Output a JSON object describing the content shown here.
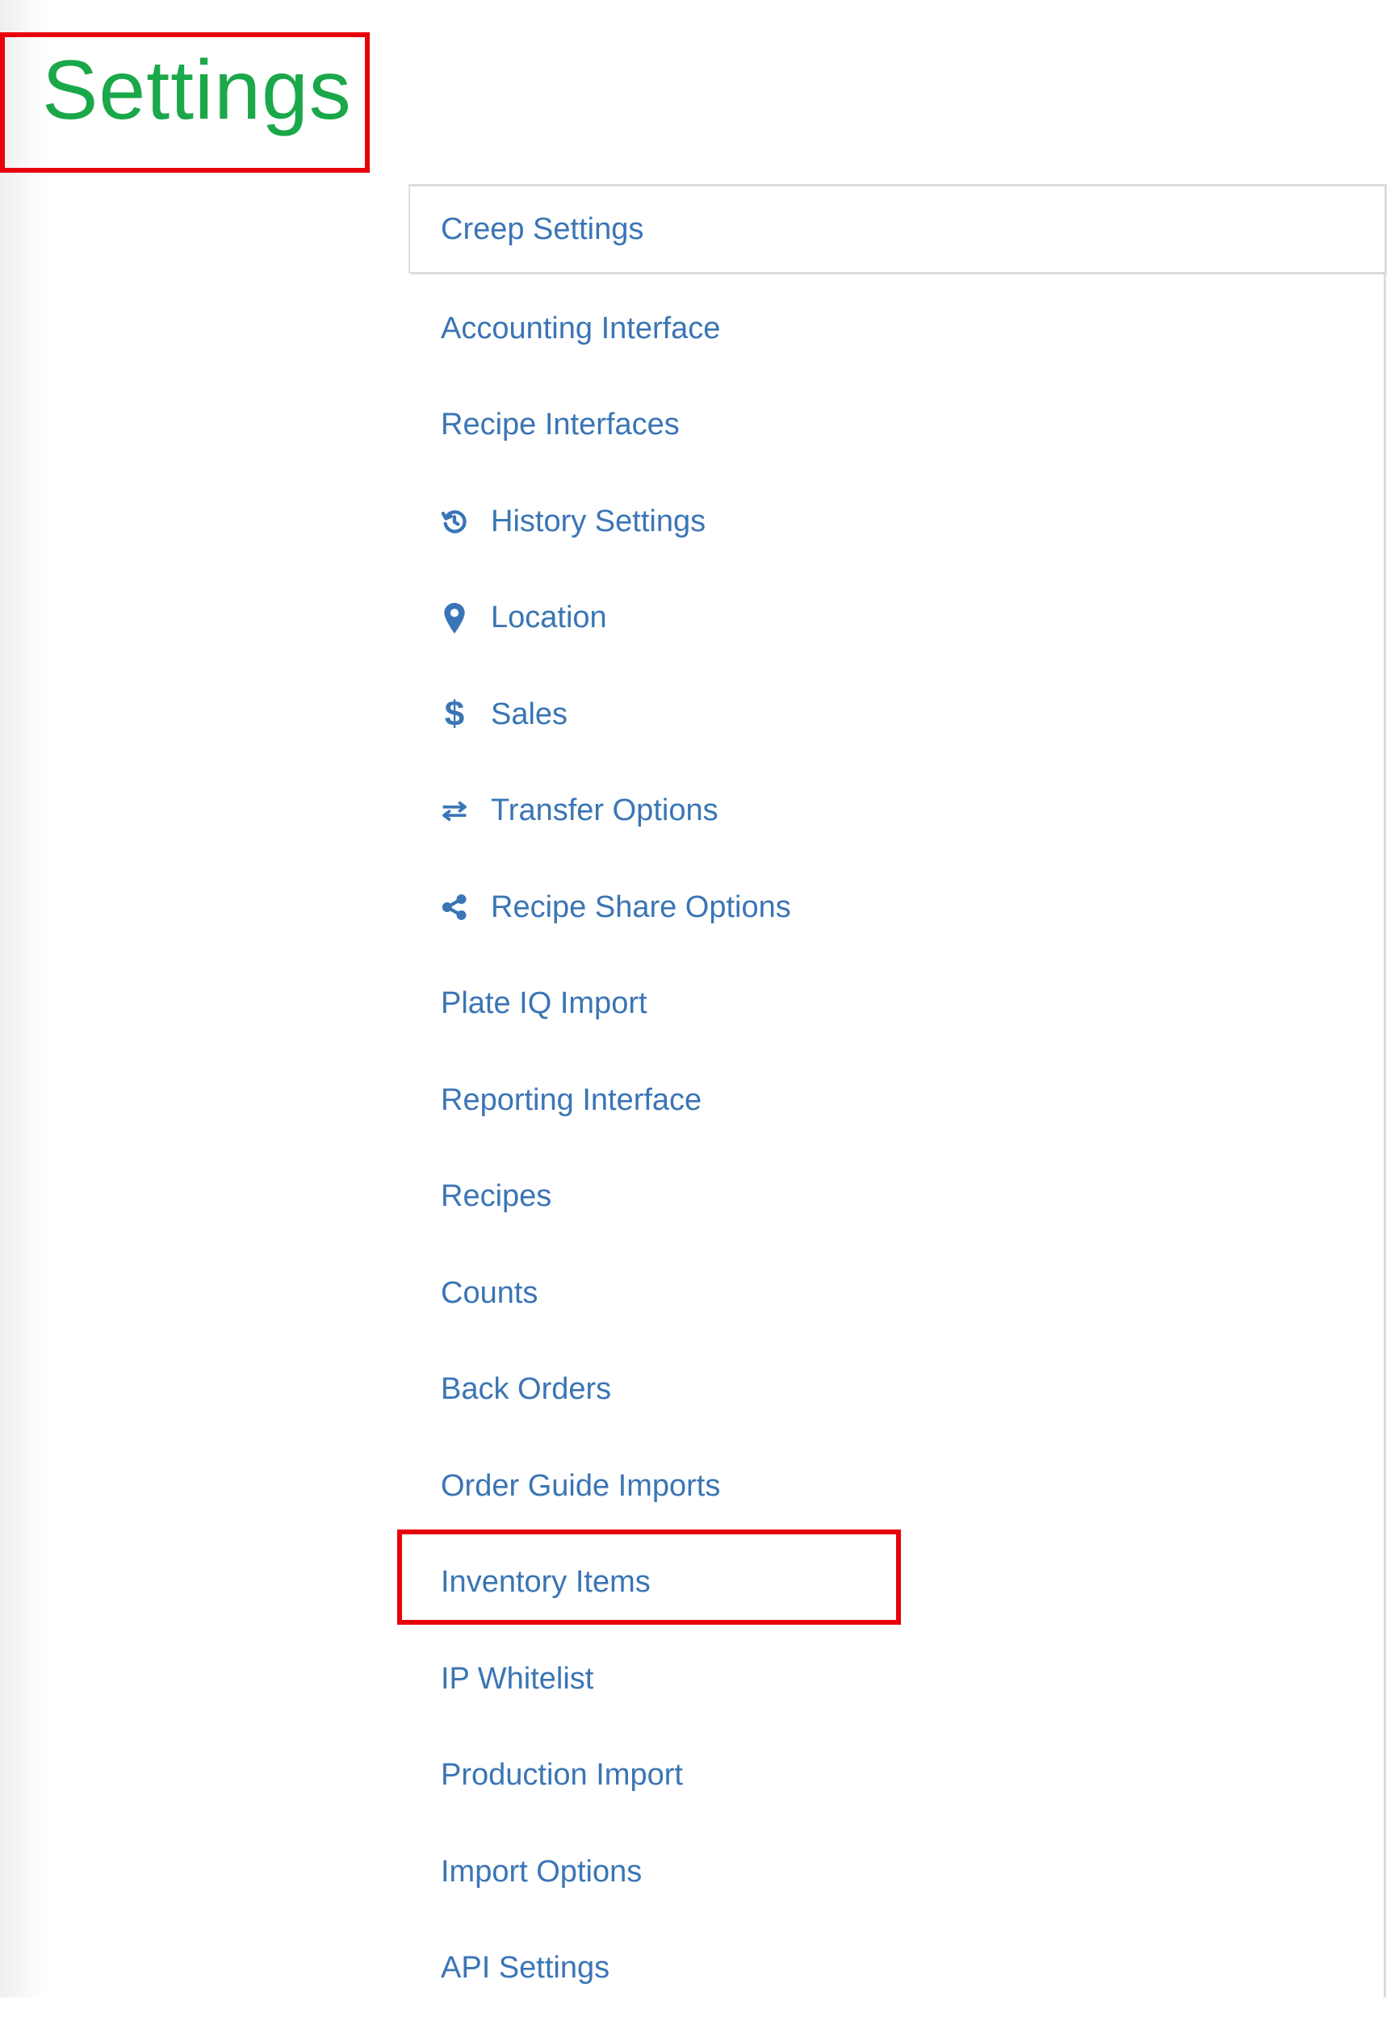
{
  "page": {
    "title": "Settings"
  },
  "menu": {
    "items": [
      {
        "label": "Creep Settings",
        "icon": null,
        "active": true
      },
      {
        "label": "Accounting Interface",
        "icon": null
      },
      {
        "label": "Recipe Interfaces",
        "icon": null
      },
      {
        "label": "History Settings",
        "icon": "history-icon"
      },
      {
        "label": "Location",
        "icon": "map-marker-icon"
      },
      {
        "label": "Sales",
        "icon": "dollar-icon"
      },
      {
        "label": "Transfer Options",
        "icon": "transfer-arrows-icon"
      },
      {
        "label": "Recipe Share Options",
        "icon": "share-icon"
      },
      {
        "label": "Plate IQ Import",
        "icon": null
      },
      {
        "label": "Reporting Interface",
        "icon": null
      },
      {
        "label": "Recipes",
        "icon": null
      },
      {
        "label": "Counts",
        "icon": null
      },
      {
        "label": "Back Orders",
        "icon": null
      },
      {
        "label": "Order Guide Imports",
        "icon": null
      },
      {
        "label": "Inventory Items",
        "icon": null,
        "highlighted": true
      },
      {
        "label": "IP Whitelist",
        "icon": null
      },
      {
        "label": "Production Import",
        "icon": null
      },
      {
        "label": "Import Options",
        "icon": null
      },
      {
        "label": "API Settings",
        "icon": null
      }
    ]
  },
  "colors": {
    "title": "#1aa84a",
    "link": "#3a75b5",
    "annotation": "#e8000b",
    "border": "#dcdcdc"
  },
  "icons": {
    "dollar_glyph": "$"
  }
}
